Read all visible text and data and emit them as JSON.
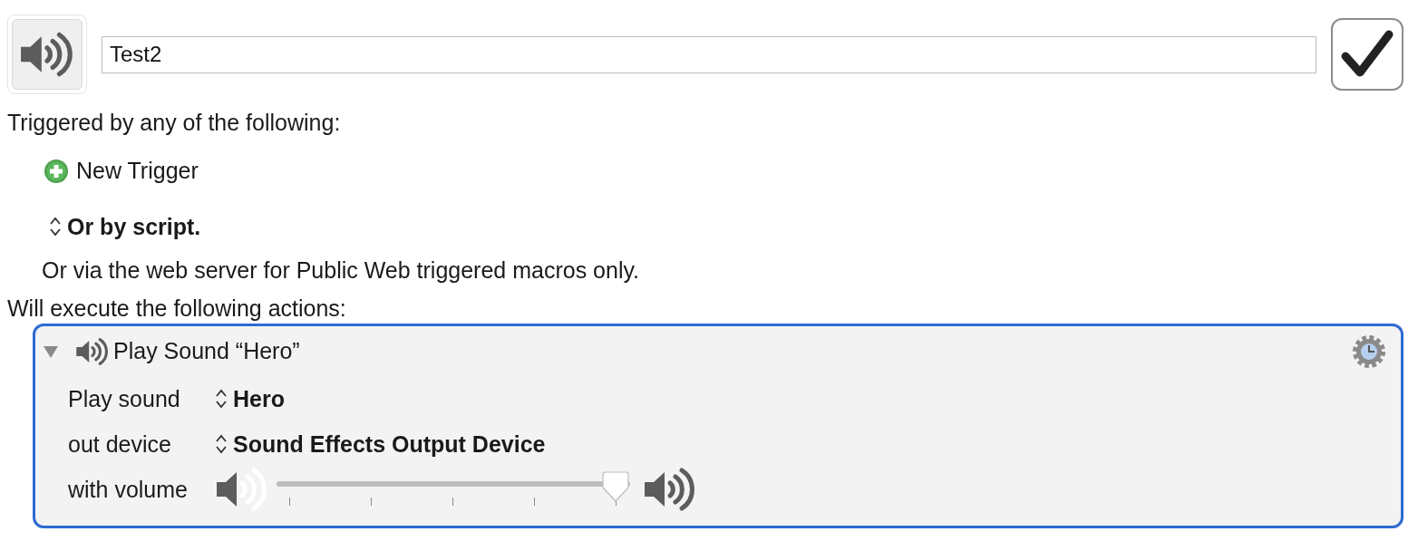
{
  "macro": {
    "name_field": {
      "value": "Test2"
    },
    "enabled": {
      "checked": true
    }
  },
  "triggers": {
    "heading": "Triggered by any of the following:",
    "new_trigger": "New Trigger",
    "script_popup": "Or by script.",
    "web_note": "Or via the web server for Public Web triggered macros only."
  },
  "actions": {
    "heading": "Will execute the following actions:",
    "items": [
      {
        "title": "Play Sound “Hero”",
        "expanded": true,
        "selected": true,
        "fields": [
          {
            "label": "Play sound",
            "kind": "popup",
            "value": "Hero"
          },
          {
            "label": "out device",
            "kind": "popup",
            "value": "Sound Effects Output Device"
          },
          {
            "label": "with volume",
            "kind": "slider",
            "level": 1
          }
        ]
      }
    ]
  }
}
